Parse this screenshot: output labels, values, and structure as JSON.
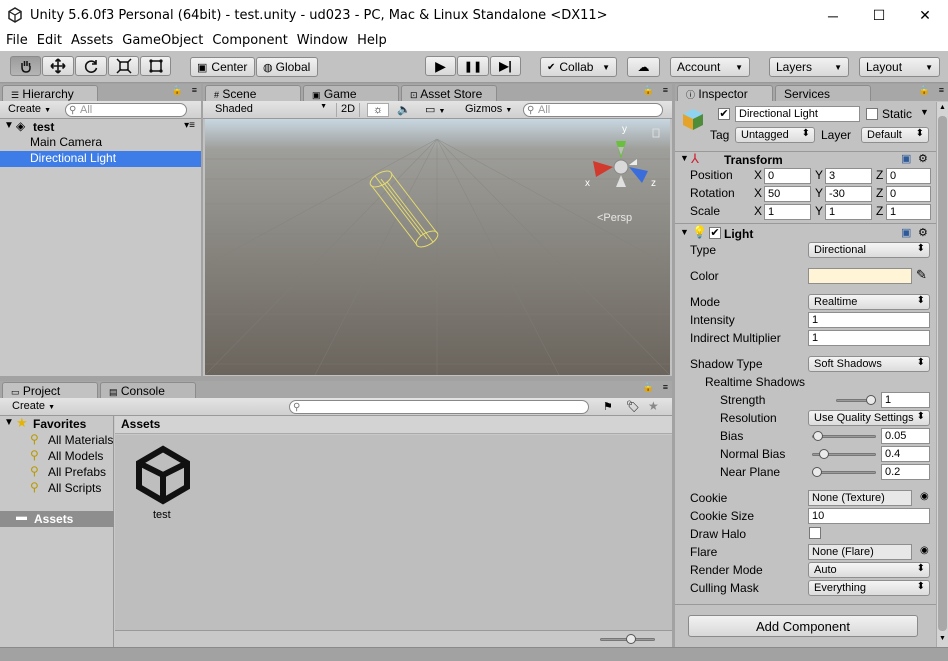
{
  "window": {
    "title": "Unity 5.6.0f3 Personal (64bit) - test.unity - ud023 - PC, Mac & Linux Standalone <DX11>",
    "minimize": "─",
    "maximize": "☐",
    "close": "✕"
  },
  "menu": [
    "File",
    "Edit",
    "Assets",
    "GameObject",
    "Component",
    "Window",
    "Help"
  ],
  "toolbar": {
    "tools": [
      "hand-tool-icon",
      "move-tool-icon",
      "rotate-tool-icon",
      "scale-tool-icon",
      "rect-tool-icon"
    ],
    "pivot": "Center",
    "space": "Global",
    "collab": "Collab",
    "account": "Account",
    "layers": "Layers",
    "layout": "Layout",
    "play": "▶",
    "pause": "❚❚",
    "step": "▶|",
    "cloud": "☁"
  },
  "hierarchy": {
    "tab": "Hierarchy",
    "create": "Create",
    "search_placeholder": "All",
    "scene": "test",
    "items": [
      "Main Camera",
      "Directional Light"
    ],
    "selected": "Directional Light"
  },
  "scene": {
    "tabs": [
      "Scene",
      "Game",
      "Asset Store"
    ],
    "shading": "Shaded",
    "mode2d": "2D",
    "gizmos": "Gizmos",
    "search_placeholder": "All",
    "persp": "<Persp",
    "axes": {
      "x": "x",
      "y": "y",
      "z": "z"
    }
  },
  "project": {
    "tabs": [
      "Project",
      "Console"
    ],
    "create": "Create",
    "favorites_label": "Favorites",
    "favorites": [
      "All Materials",
      "All Models",
      "All Prefabs",
      "All Scripts"
    ],
    "assets_label": "Assets",
    "assets_header": "Assets",
    "asset_items": [
      "test"
    ]
  },
  "inspector": {
    "tabs": [
      "Inspector",
      "Services"
    ],
    "object_name": "Directional Light",
    "static_label": "Static",
    "tag_label": "Tag",
    "tag_value": "Untagged",
    "layer_label": "Layer",
    "layer_value": "Default",
    "transform": {
      "title": "Transform",
      "rows": [
        {
          "label": "Position",
          "x": "0",
          "y": "3",
          "z": "0"
        },
        {
          "label": "Rotation",
          "x": "50",
          "y": "-30",
          "z": "0"
        },
        {
          "label": "Scale",
          "x": "1",
          "y": "1",
          "z": "1"
        }
      ],
      "axis_x": "X",
      "axis_y": "Y",
      "axis_z": "Z"
    },
    "light": {
      "title": "Light",
      "type_label": "Type",
      "type_value": "Directional",
      "color_label": "Color",
      "color_value": "#fff4d6",
      "mode_label": "Mode",
      "mode_value": "Realtime",
      "intensity_label": "Intensity",
      "intensity_value": "1",
      "indirect_label": "Indirect Multiplier",
      "indirect_value": "1",
      "shadow_type_label": "Shadow Type",
      "shadow_type_value": "Soft Shadows",
      "realtime_shadows_label": "Realtime Shadows",
      "strength_label": "Strength",
      "strength_value": "1",
      "strength_level": 1.0,
      "resolution_label": "Resolution",
      "resolution_value": "Use Quality Settings",
      "bias_label": "Bias",
      "bias_value": "0.05",
      "bias_level": 0.025,
      "normal_bias_label": "Normal Bias",
      "normal_bias_value": "0.4",
      "normal_bias_level": 0.13,
      "near_plane_label": "Near Plane",
      "near_plane_value": "0.2",
      "near_plane_level": 0.0,
      "cookie_label": "Cookie",
      "cookie_value": "None (Texture)",
      "cookie_size_label": "Cookie Size",
      "cookie_size_value": "10",
      "draw_halo_label": "Draw Halo",
      "flare_label": "Flare",
      "flare_value": "None (Flare)",
      "render_mode_label": "Render Mode",
      "render_mode_value": "Auto",
      "culling_mask_label": "Culling Mask",
      "culling_mask_value": "Everything"
    },
    "add_component": "Add Component"
  }
}
